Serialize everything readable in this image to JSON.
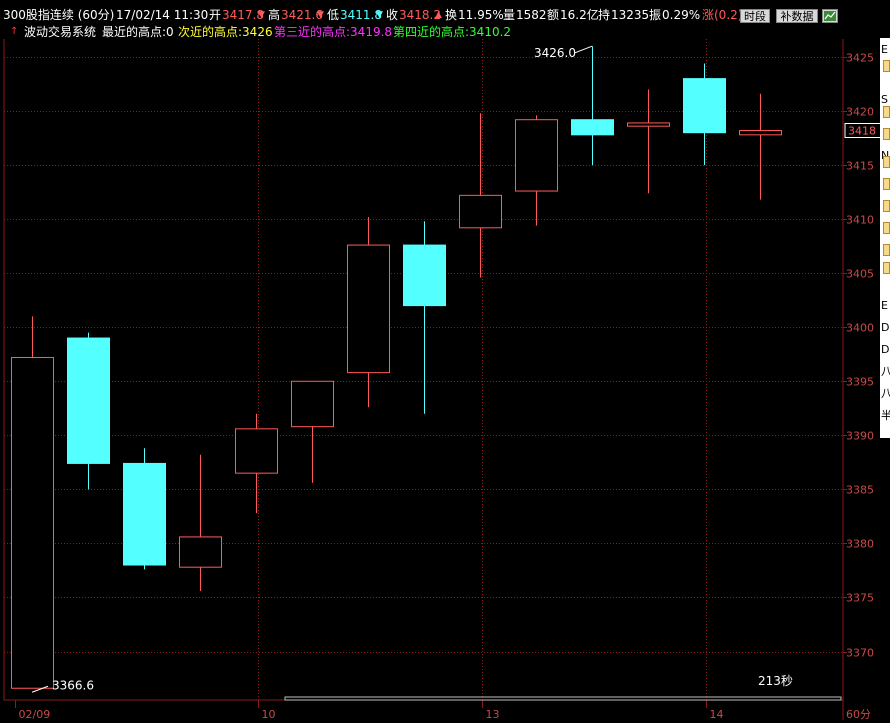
{
  "header": {
    "title": "300股指连续 (60分)",
    "datetime": "17/02/14 11:30",
    "open_label": "开",
    "open_value": "3417.8",
    "high_label": "高",
    "high_value": "3421.6",
    "low_label": "低",
    "low_value": "3411.8",
    "close_label": "收",
    "close_value": "3418.2",
    "turnover_label": "换",
    "turnover_value": "11.95%",
    "volume_label": "量",
    "volume_value": "1582",
    "amount_label": "额",
    "amount_value": "16.2亿",
    "holding_label": "持",
    "holding_value": "13235",
    "amplitude_label": "振",
    "amplitude_value": "0.29%",
    "change_label": "涨",
    "change_value": "(0.2)",
    "period_button": "时段",
    "supplement_button": "补数据",
    "up_arrow": "▼",
    "dn_arrow": "▼",
    "close_arrow": "▲"
  },
  "indicator": {
    "name": "波动交易系统",
    "recent_high": "最近的高点:0",
    "second_high": "次近的高点:3426",
    "third_high": "第三近的高点:3419.8",
    "fourth_high": "第四近的高点:3410.2"
  },
  "colors": {
    "up": "#ff5a5a",
    "down": "#54ffff",
    "grid": "#8b1a1a",
    "axis_text": "#c84a4a",
    "yellow": "#ffff33",
    "magenta": "#ff33ff",
    "green": "#33ff33"
  },
  "right_panel_glyphs": [
    "E",
    "S",
    "N",
    "E",
    "D",
    "D",
    "八",
    "八",
    "半"
  ],
  "chart_data": {
    "type": "candlestick",
    "ylim": [
      3366,
      3428
    ],
    "yticks": [
      3370,
      3375,
      3380,
      3385,
      3390,
      3395,
      3400,
      3405,
      3410,
      3415,
      3420,
      3425
    ],
    "current_price_label": "3418",
    "current_price": 3418.2,
    "x_labels": [
      {
        "label": "02/09",
        "index": 0
      },
      {
        "label": "10",
        "index": 4.3
      },
      {
        "label": "13",
        "index": 8.3
      },
      {
        "label": "14",
        "index": 12.3
      }
    ],
    "period_label": "60分",
    "countdown": "213秒",
    "candles": [
      {
        "open": 3366.6,
        "close": 3397.2,
        "high": 3401.0,
        "low": 3366.6
      },
      {
        "open": 3399.0,
        "close": 3387.4,
        "high": 3399.5,
        "low": 3385.0
      },
      {
        "open": 3387.4,
        "close": 3378.0,
        "high": 3388.8,
        "low": 3377.6
      },
      {
        "open": 3377.8,
        "close": 3380.6,
        "high": 3388.2,
        "low": 3375.6
      },
      {
        "open": 3386.5,
        "close": 3390.6,
        "high": 3392.0,
        "low": 3382.8
      },
      {
        "open": 3390.8,
        "close": 3395.0,
        "high": 3395.0,
        "low": 3385.6
      },
      {
        "open": 3395.8,
        "close": 3407.6,
        "high": 3410.2,
        "low": 3392.6
      },
      {
        "open": 3407.6,
        "close": 3402.0,
        "high": 3409.8,
        "low": 3392.0
      },
      {
        "open": 3409.2,
        "close": 3412.2,
        "high": 3419.8,
        "low": 3404.6
      },
      {
        "open": 3412.6,
        "close": 3419.2,
        "high": 3419.6,
        "low": 3409.4
      },
      {
        "open": 3419.2,
        "close": 3417.8,
        "high": 3426.0,
        "low": 3415.0
      },
      {
        "open": 3418.6,
        "close": 3418.9,
        "high": 3422.0,
        "low": 3412.4
      },
      {
        "open": 3423.0,
        "close": 3418.0,
        "high": 3424.4,
        "low": 3415.0
      },
      {
        "open": 3417.8,
        "close": 3418.2,
        "high": 3421.6,
        "low": 3411.8
      }
    ],
    "annotations": [
      {
        "text": "3426.0",
        "value": 3426.0,
        "index": 10
      },
      {
        "text": "3366.6",
        "value": 3366.6,
        "index": 0
      }
    ]
  }
}
